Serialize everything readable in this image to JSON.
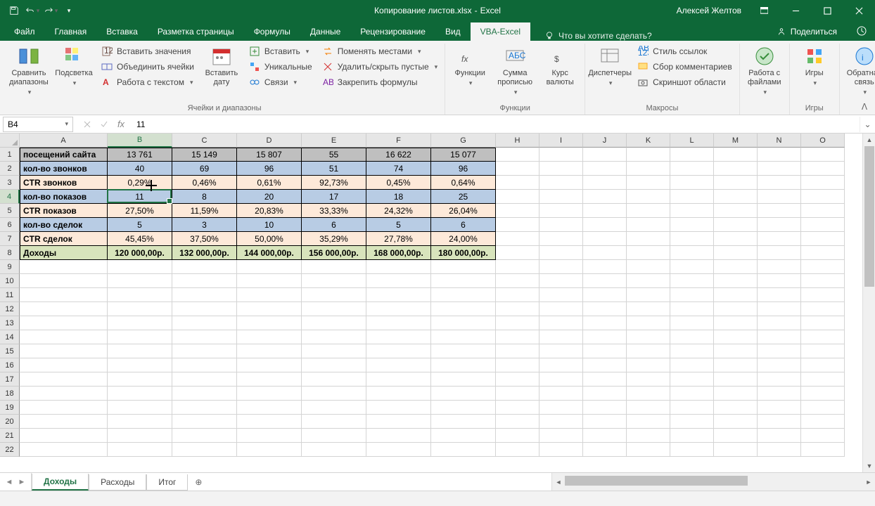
{
  "title": {
    "filename": "Копирование листов.xlsx",
    "app": "Excel"
  },
  "user": "Алексей Желтов",
  "tabs": {
    "file": "Файл",
    "items": [
      "Главная",
      "Вставка",
      "Разметка страницы",
      "Формулы",
      "Данные",
      "Рецензирование",
      "Вид",
      "VBA-Excel"
    ],
    "active": "VBA-Excel",
    "tell_me": "Что вы хотите сделать?",
    "share": "Поделиться"
  },
  "ribbon": {
    "g1": {
      "btn1": "Сравнить диапазоны",
      "btn2": "Подсветка",
      "s1": "Вставить значения",
      "s2": "Объединить ячейки",
      "s3": "Работа с текстом",
      "btn3": "Вставить дату",
      "s4": "Вставить",
      "s5": "Уникальные",
      "s6": "Связи",
      "s7": "Поменять местами",
      "s8": "Удалить/скрыть пустые",
      "s9": "Закрепить формулы",
      "label": "Ячейки и диапазоны"
    },
    "g2": {
      "btn1": "Функции",
      "btn2": "Сумма прописью",
      "btn3": "Курс валюты",
      "label": "Функции"
    },
    "g3": {
      "btn1": "Диспетчеры",
      "s1": "Стиль ссылок",
      "s2": "Сбор комментариев",
      "s3": "Скриншот области",
      "label": "Макросы"
    },
    "g4": {
      "btn1": "Работа с файлами"
    },
    "g5": {
      "btn1": "Игры",
      "label": "Игры"
    },
    "g6": {
      "btn1": "Обратная связь"
    }
  },
  "namebox": "B4",
  "formula_value": "11",
  "columns": [
    "A",
    "B",
    "C",
    "D",
    "E",
    "F",
    "G",
    "H",
    "I",
    "J",
    "K",
    "L",
    "M",
    "N",
    "O"
  ],
  "sel_col": "B",
  "sel_row": 4,
  "rows": {
    "labels": [
      "посещений сайта",
      "кол-во звонков",
      "CTR звонков",
      "кол-во показов",
      "CTR показов",
      "кол-во сделок",
      "CTR сделок",
      "Доходы"
    ],
    "data": [
      [
        "13 761",
        "15 149",
        "15 807",
        "55",
        "16 622",
        "15 077"
      ],
      [
        "40",
        "69",
        "96",
        "51",
        "74",
        "96"
      ],
      [
        "0,29%",
        "0,46%",
        "0,61%",
        "92,73%",
        "0,45%",
        "0,64%"
      ],
      [
        "11",
        "8",
        "20",
        "17",
        "18",
        "25"
      ],
      [
        "27,50%",
        "11,59%",
        "20,83%",
        "33,33%",
        "24,32%",
        "26,04%"
      ],
      [
        "5",
        "3",
        "10",
        "6",
        "5",
        "6"
      ],
      [
        "45,45%",
        "37,50%",
        "50,00%",
        "35,29%",
        "27,78%",
        "24,00%"
      ],
      [
        "120 000,00р.",
        "132 000,00р.",
        "144 000,00р.",
        "156 000,00р.",
        "168 000,00р.",
        "180 000,00р."
      ]
    ],
    "row_styles": [
      "r-gray",
      "r-blue",
      "r-yel",
      "r-blue",
      "r-yel",
      "r-blue",
      "r-yel",
      "r-grn"
    ]
  },
  "visible_rows": 22,
  "sheets": {
    "items": [
      "Доходы",
      "Расходы",
      "Итог"
    ],
    "active": "Доходы"
  }
}
